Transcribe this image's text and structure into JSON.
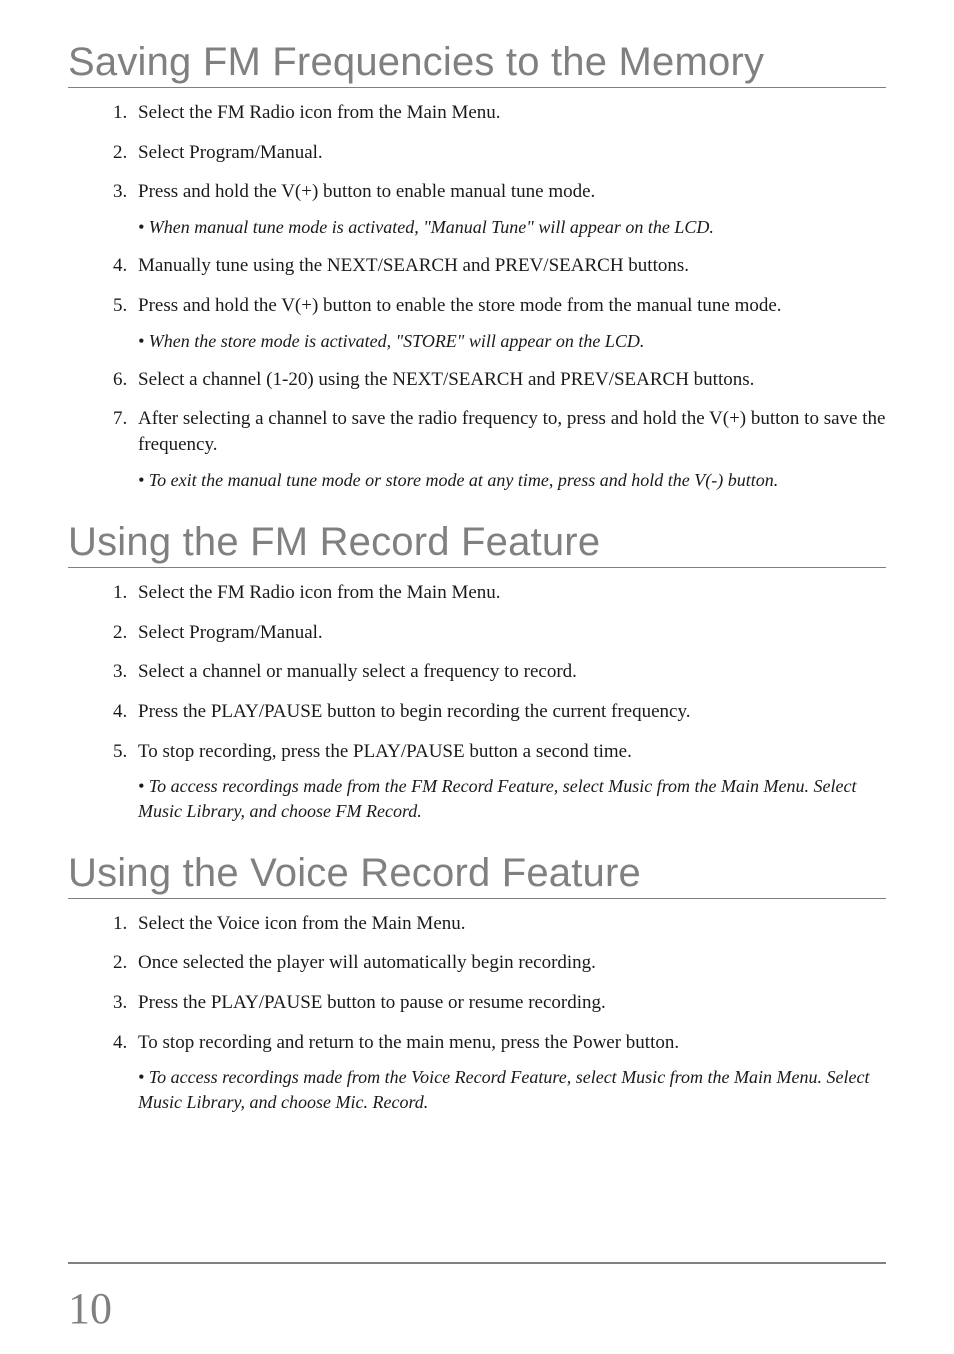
{
  "sections": [
    {
      "title": "Saving FM Frequencies to the Memory",
      "steps": [
        {
          "text": "Select the FM Radio icon from the Main Menu."
        },
        {
          "text": "Select Program/Manual."
        },
        {
          "text": "Press and hold the V(+) button to enable manual tune mode.",
          "note": "• When manual tune mode is activated, \"Manual Tune\" will appear on the LCD."
        },
        {
          "text": "Manually tune using the NEXT/SEARCH and PREV/SEARCH buttons."
        },
        {
          "text": "Press and hold the V(+) button to enable the store mode from the manual tune mode.",
          "note": "• When the store mode is activated, \"STORE\" will appear on the LCD."
        },
        {
          "text": "Select a channel (1-20) using the NEXT/SEARCH and PREV/SEARCH buttons."
        },
        {
          "text": "After selecting a channel to save the radio frequency to, press and hold the V(+) button to save the frequency.",
          "note": "• To exit the manual tune mode or store mode at any time, press and hold the V(-) button."
        }
      ]
    },
    {
      "title": "Using the FM Record Feature",
      "steps": [
        {
          "text": "Select the FM Radio icon from the Main Menu."
        },
        {
          "text": "Select Program/Manual."
        },
        {
          "text": "Select a channel or manually select a frequency to record."
        },
        {
          "text": "Press the PLAY/PAUSE button to begin recording the current frequency."
        },
        {
          "text": "To stop recording, press the PLAY/PAUSE button a second time.",
          "note": "• To access recordings made from the FM Record Feature, select Music from the Main Menu.  Select Music Library, and choose FM Record."
        }
      ]
    },
    {
      "title": "Using the Voice Record Feature",
      "steps": [
        {
          "text": "Select the Voice icon from the Main Menu."
        },
        {
          "text": "Once selected the player will automatically begin recording."
        },
        {
          "text": "Press the PLAY/PAUSE button to pause or resume recording."
        },
        {
          "text": "To stop recording and return to the main menu, press the Power button.",
          "note": "• To access recordings made from the Voice Record Feature, select Music from the Main Menu.  Select Music Library, and choose Mic. Record."
        }
      ]
    }
  ],
  "page_number": "10"
}
